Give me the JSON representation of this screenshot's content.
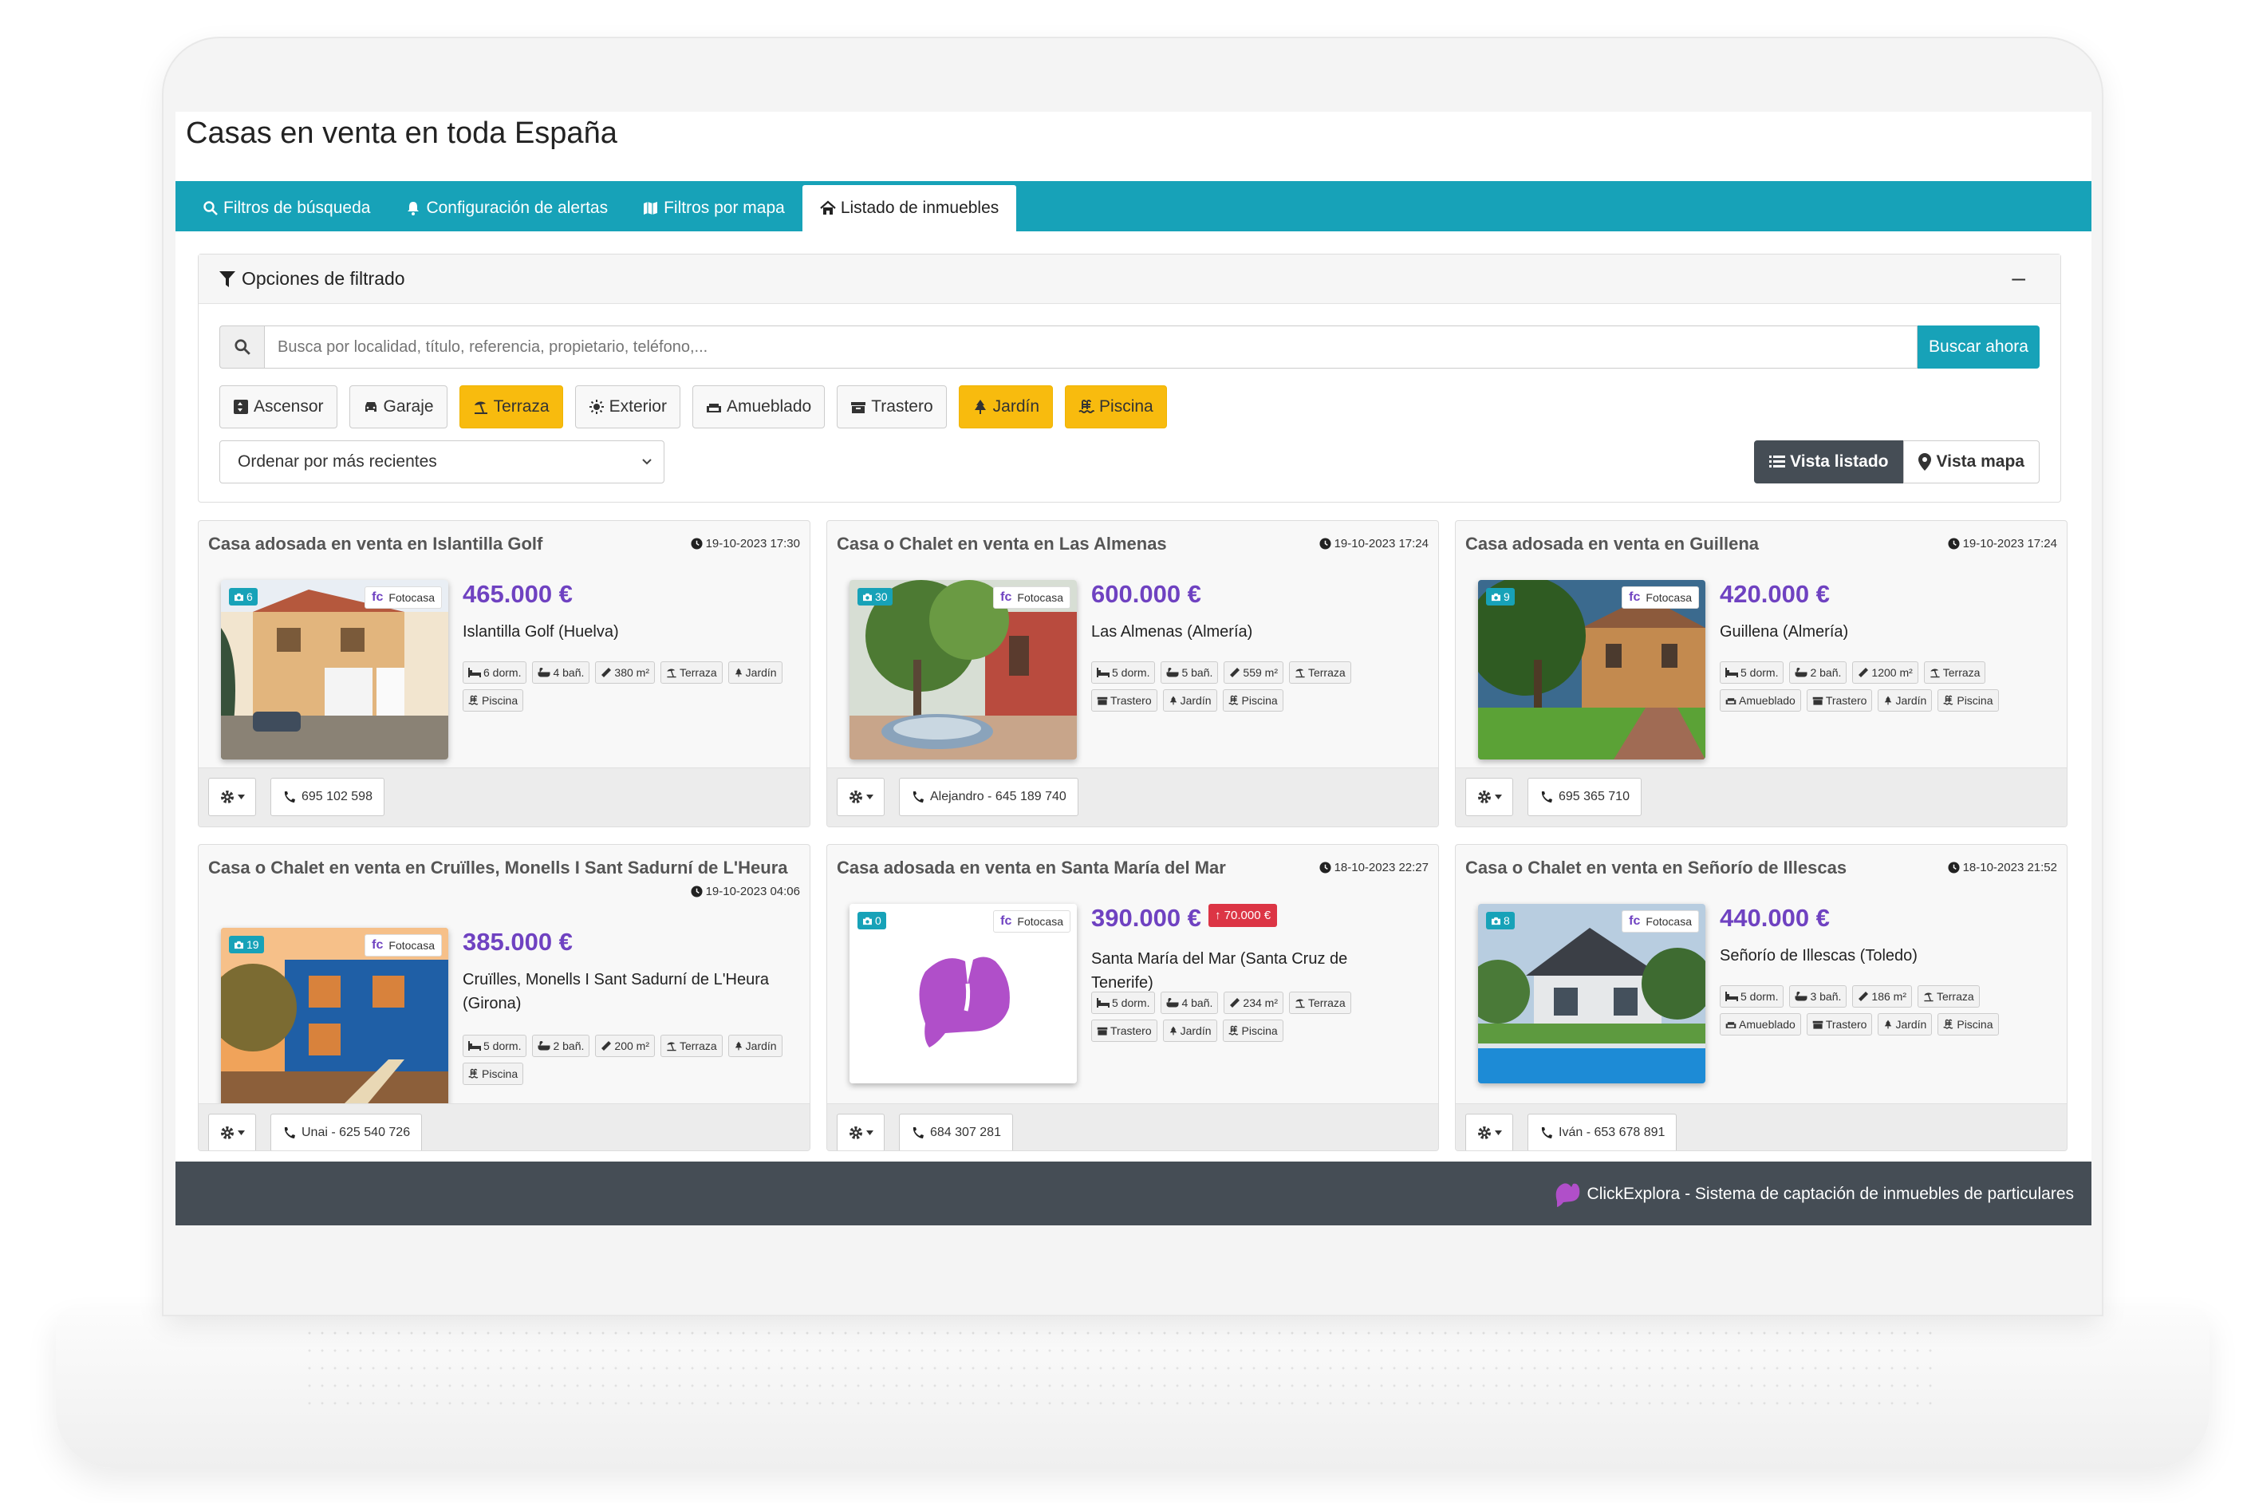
{
  "page": {
    "title": "Casas en venta en toda España"
  },
  "tabs": [
    {
      "label": "Filtros de búsqueda",
      "icon": "search-icon"
    },
    {
      "label": "Configuración de alertas",
      "icon": "bell-icon"
    },
    {
      "label": "Filtros por mapa",
      "icon": "map-icon"
    },
    {
      "label": "Listado de inmuebles",
      "icon": "home-icon",
      "active": true
    }
  ],
  "filters": {
    "heading": "Opciones de filtrado",
    "collapse_label": "–",
    "search_placeholder": "Busca por localidad, título, referencia, propietario, teléfono,...",
    "search_button": "Buscar ahora",
    "chips": [
      {
        "label": "Ascensor",
        "active": false
      },
      {
        "label": "Garaje",
        "active": false
      },
      {
        "label": "Terraza",
        "active": true
      },
      {
        "label": "Exterior",
        "active": false
      },
      {
        "label": "Amueblado",
        "active": false
      },
      {
        "label": "Trastero",
        "active": false
      },
      {
        "label": "Jardín",
        "active": true
      },
      {
        "label": "Piscina",
        "active": true
      }
    ],
    "sort_label": "Ordenar por más recientes",
    "view_list": "Vista listado",
    "view_map": "Vista mapa"
  },
  "listings": [
    {
      "title": "Casa adosada en venta en Islantilla Golf",
      "date": "19-10-2023 17:30",
      "photo_count": "6",
      "source": "Fotocasa",
      "price": "465.000 €",
      "location": "Islantilla Golf (Huelva)",
      "features": [
        "6 dorm.",
        "4 bañ.",
        "380 m²",
        "Terraza",
        "Jardín",
        "Piscina"
      ],
      "phone": "695 102 598"
    },
    {
      "title": "Casa o Chalet en venta en Las Almenas",
      "date": "19-10-2023 17:24",
      "photo_count": "30",
      "source": "Fotocasa",
      "price": "600.000 €",
      "location": "Las Almenas (Almería)",
      "features": [
        "5 dorm.",
        "5 bañ.",
        "559 m²",
        "Terraza",
        "Trastero",
        "Jardín",
        "Piscina"
      ],
      "phone": "Alejandro - 645 189 740"
    },
    {
      "title": "Casa adosada en venta en Guillena",
      "date": "19-10-2023 17:24",
      "photo_count": "9",
      "source": "Fotocasa",
      "price": "420.000 €",
      "location": "Guillena (Almería)",
      "features": [
        "5 dorm.",
        "2 bañ.",
        "1200 m²",
        "Terraza",
        "Amueblado",
        "Trastero",
        "Jardín",
        "Piscina"
      ],
      "phone": "695 365 710"
    },
    {
      "title": "Casa o Chalet en venta en Cruïlles, Monells I Sant Sadurní de L'Heura",
      "date": "19-10-2023 04:06",
      "photo_count": "19",
      "source": "Fotocasa",
      "price": "385.000 €",
      "location": "Cruïlles, Monells I Sant Sadurní de L'Heura (Girona)",
      "features": [
        "5 dorm.",
        "2 bañ.",
        "200 m²",
        "Terraza",
        "Jardín",
        "Piscina"
      ],
      "phone": "Unai - 625 540 726"
    },
    {
      "title": "Casa adosada en venta en Santa María del Mar",
      "date": "18-10-2023 22:27",
      "photo_count": "0",
      "source": "Fotocasa",
      "price": "390.000 €",
      "price_drop": "70.000 €",
      "location": "Santa María del Mar (Santa Cruz de Tenerife)",
      "features": [
        "5 dorm.",
        "4 bañ.",
        "234 m²",
        "Terraza",
        "Trastero",
        "Jardín",
        "Piscina"
      ],
      "phone": "684 307 281"
    },
    {
      "title": "Casa o Chalet en venta en Señorío de Illescas",
      "date": "18-10-2023 21:52",
      "photo_count": "8",
      "source": "Fotocasa",
      "price": "440.000 €",
      "location": "Señorío de Illescas (Toledo)",
      "features": [
        "5 dorm.",
        "3 bañ.",
        "186 m²",
        "Terraza",
        "Amueblado",
        "Trastero",
        "Jardín",
        "Piscina"
      ],
      "phone": "Iván - 653 678 891"
    }
  ],
  "footer": {
    "text": "ClickExplora - Sistema de captación de inmuebles de particulares"
  },
  "colors": {
    "primary": "#17a2b8",
    "accent": "#f8bb0e",
    "price": "#6f42c1",
    "dark": "#454d55",
    "danger": "#dc3545"
  }
}
